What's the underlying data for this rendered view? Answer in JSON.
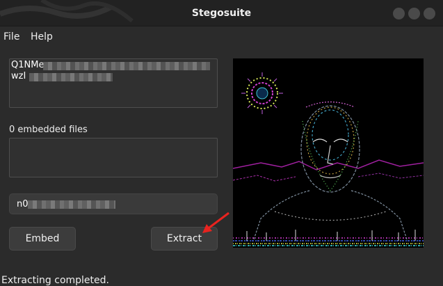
{
  "window": {
    "title": "Stegosuite"
  },
  "menu": {
    "items": [
      "File",
      "Help"
    ]
  },
  "message": {
    "line1_prefix": "Q1NMe",
    "line2_prefix": "wzI"
  },
  "files": {
    "label": "0 embedded files"
  },
  "password": {
    "value_prefix": "n0"
  },
  "buttons": {
    "embed": "Embed",
    "extract": "Extract"
  },
  "status": {
    "text": "Extracting completed."
  },
  "colors": {
    "background": "#2b2b2b",
    "annotation_arrow": "#e8231f"
  }
}
